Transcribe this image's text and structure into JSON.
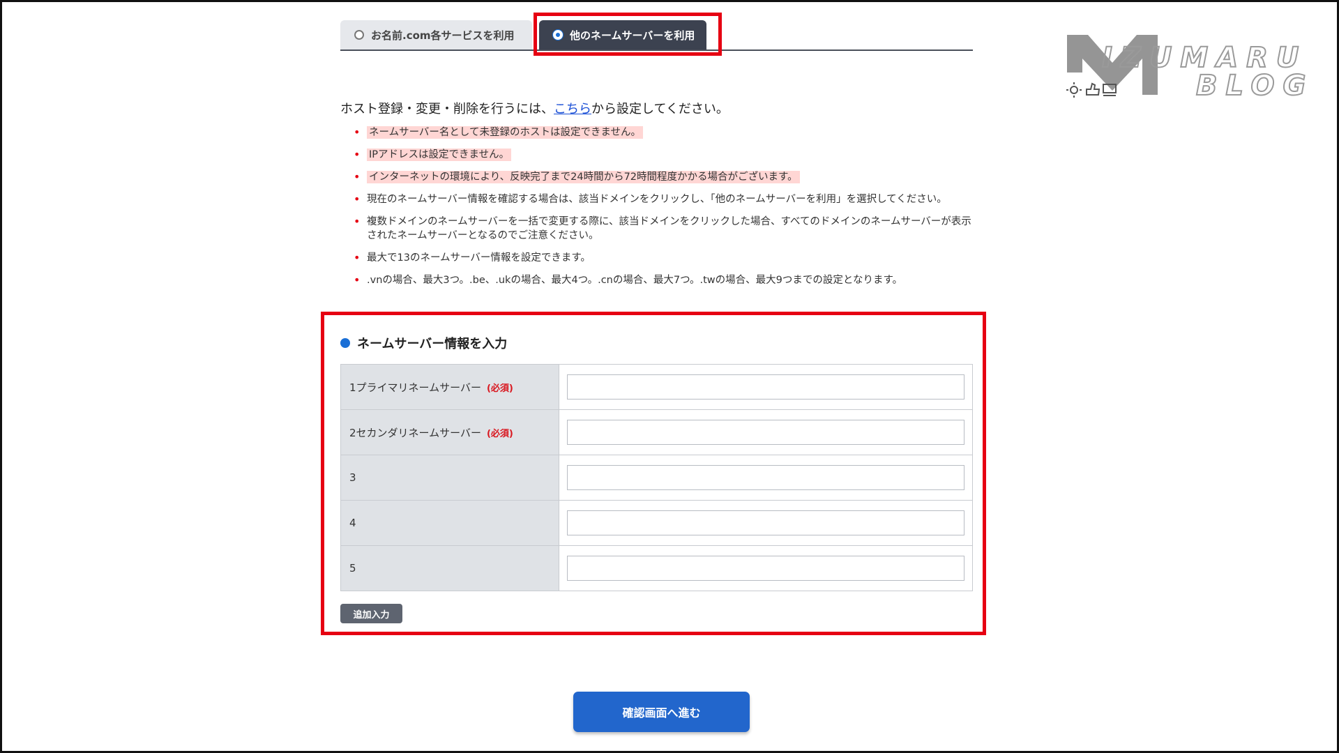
{
  "tabs": [
    {
      "label": "お名前.com各サービスを利用",
      "selected": false
    },
    {
      "label": "他のネームサーバーを利用",
      "selected": true
    }
  ],
  "intro": {
    "before": "ホスト登録・変更・削除を行うには、",
    "link": "こちら",
    "after": "から設定してください。"
  },
  "notes": [
    "ネームサーバー名として未登録のホストは設定できません。",
    "IPアドレスは設定できません。",
    "インターネットの環境により、反映完了まで24時間から72時間程度かかる場合がございます。",
    "現在のネームサーバー情報を確認する場合は、該当ドメインをクリックし、「他のネームサーバーを利用」を選択してください。",
    "複数ドメインのネームサーバーを一括で変更する際に、該当ドメインをクリックした場合、すべてのドメインのネームサーバーが表示されたネームサーバーとなるのでご注意ください。",
    "最大で13のネームサーバー情報を設定できます。",
    ".vnの場合、最大3つ。.be、.ukの場合、最大4つ。.cnの場合、最大7つ。.twの場合、最大9つまでの設定となります。"
  ],
  "section_title": "ネームサーバー情報を入力",
  "rows": [
    {
      "label": "1プライマリネームサーバー",
      "required": "(必須)",
      "value": ""
    },
    {
      "label": "2セカンダリネームサーバー",
      "required": "(必須)",
      "value": ""
    },
    {
      "label": "3",
      "required": "",
      "value": ""
    },
    {
      "label": "4",
      "required": "",
      "value": ""
    },
    {
      "label": "5",
      "required": "",
      "value": ""
    }
  ],
  "add_button": "追加入力",
  "confirm_button": "確認画面へ進む",
  "logo": {
    "line1": "IZUMARU",
    "line2": "BLOG"
  },
  "colors": {
    "accent": "#1a6fd6",
    "highlight": "#e60012",
    "tab_active": "#3c4250"
  }
}
